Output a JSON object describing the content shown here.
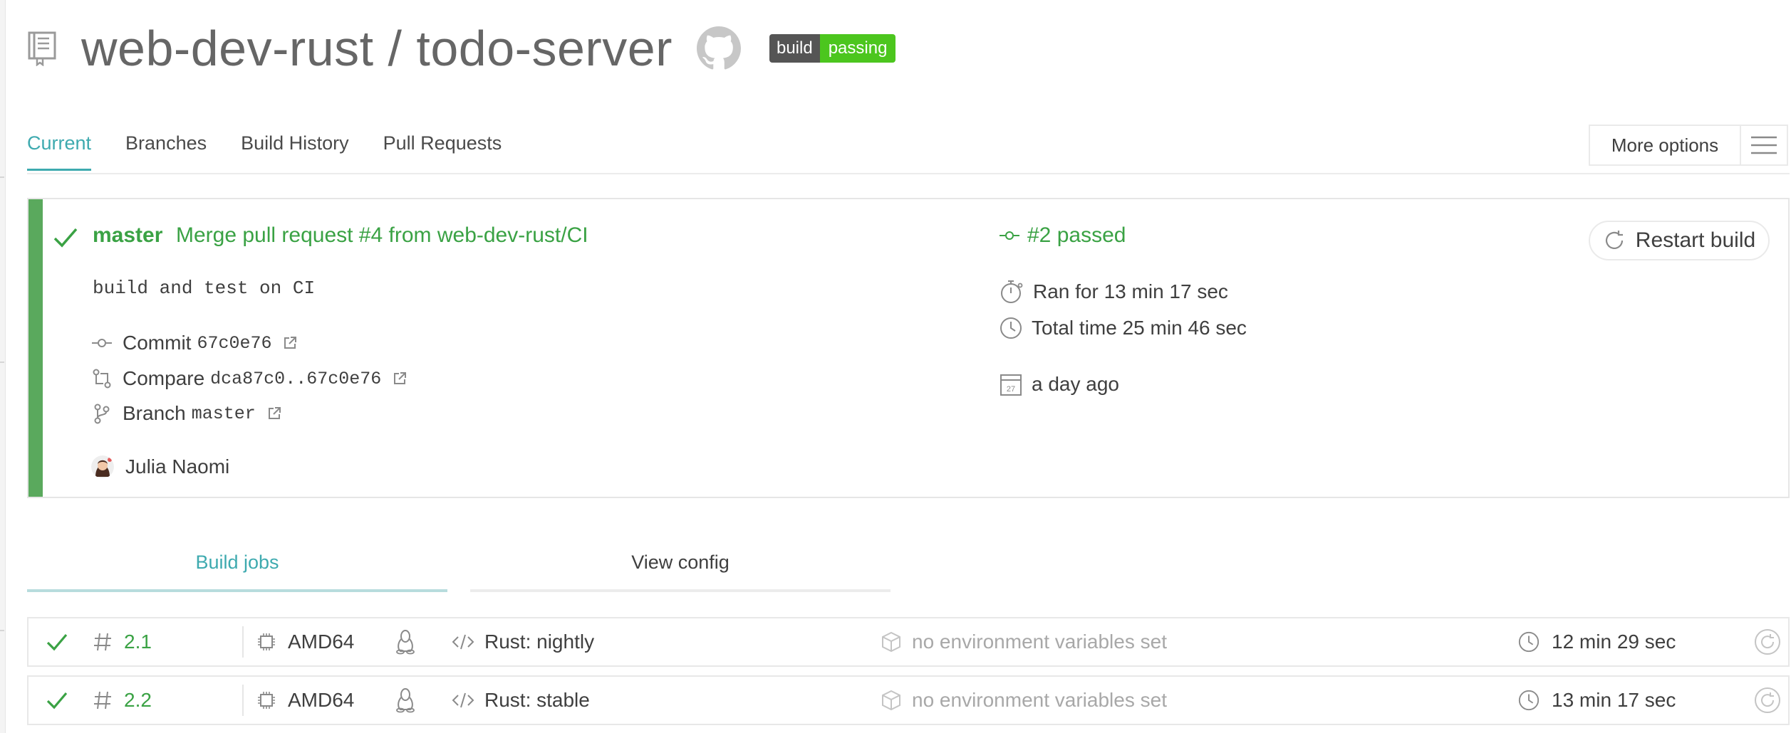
{
  "header": {
    "repo_title": "web-dev-rust / todo-server",
    "badge_left": "build",
    "badge_right": "passing",
    "icons": [
      "repo-icon",
      "github-icon"
    ]
  },
  "tabs": [
    {
      "label": "Current",
      "active": true
    },
    {
      "label": "Branches",
      "active": false
    },
    {
      "label": "Build History",
      "active": false
    },
    {
      "label": "Pull Requests",
      "active": false
    }
  ],
  "more_options": {
    "label": "More options",
    "icon": "hamburger-icon"
  },
  "build": {
    "branch": "master",
    "commit_message": "Merge pull request #4 from web-dev-rust/CI",
    "description": "build and test on CI",
    "commit_label": "Commit",
    "commit_sha": "67c0e76",
    "compare_label": "Compare",
    "compare_range": "dca87c0..67c0e76",
    "branch_label": "Branch",
    "branch_value": "master",
    "author": "Julia Naomi",
    "status": "#2 passed",
    "ran_for": "Ran for 13 min 17 sec",
    "total_time": "Total time 25 min 46 sec",
    "when": "a day ago",
    "calendar_day": "27",
    "restart_label": "Restart build",
    "status_color": "#3aa244"
  },
  "subtabs": {
    "jobs": "Build jobs",
    "config": "View config"
  },
  "jobs": [
    {
      "number": "2.1",
      "arch": "AMD64",
      "os_icon": "linux-icon",
      "language": "Rust: nightly",
      "env": "no environment variables set",
      "duration": "12 min 29 sec"
    },
    {
      "number": "2.2",
      "arch": "AMD64",
      "os_icon": "linux-icon",
      "language": "Rust: stable",
      "env": "no environment variables set",
      "duration": "13 min 17 sec"
    }
  ],
  "colors": {
    "accent": "#3eaaaf",
    "success": "#3aa244",
    "success_bar": "#5aa95d",
    "badge_pass": "#4cc61e"
  }
}
